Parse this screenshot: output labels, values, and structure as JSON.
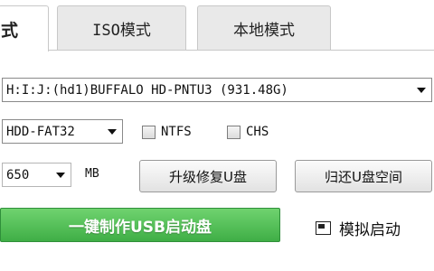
{
  "tabs": [
    {
      "label": "式",
      "active": true
    },
    {
      "label": "ISO模式",
      "active": false
    },
    {
      "label": "本地模式",
      "active": false
    }
  ],
  "disk_select": {
    "value": "H:I:J:(hd1)BUFFALO HD-PNTU3 (931.48G)"
  },
  "format_select": {
    "value": "HDD-FAT32"
  },
  "options": {
    "ntfs_label": "NTFS",
    "chs_label": "CHS"
  },
  "size_select": {
    "value": "650"
  },
  "size_unit": "MB",
  "buttons": {
    "upgrade_repair": "升级修复U盘",
    "restore_space": "归还U盘空间",
    "make_boot": "一键制作USB启动盘"
  },
  "simulate_label": "模拟启动",
  "colors": {
    "accent_green": "#4cbb52",
    "border": "#c8c8c8"
  }
}
